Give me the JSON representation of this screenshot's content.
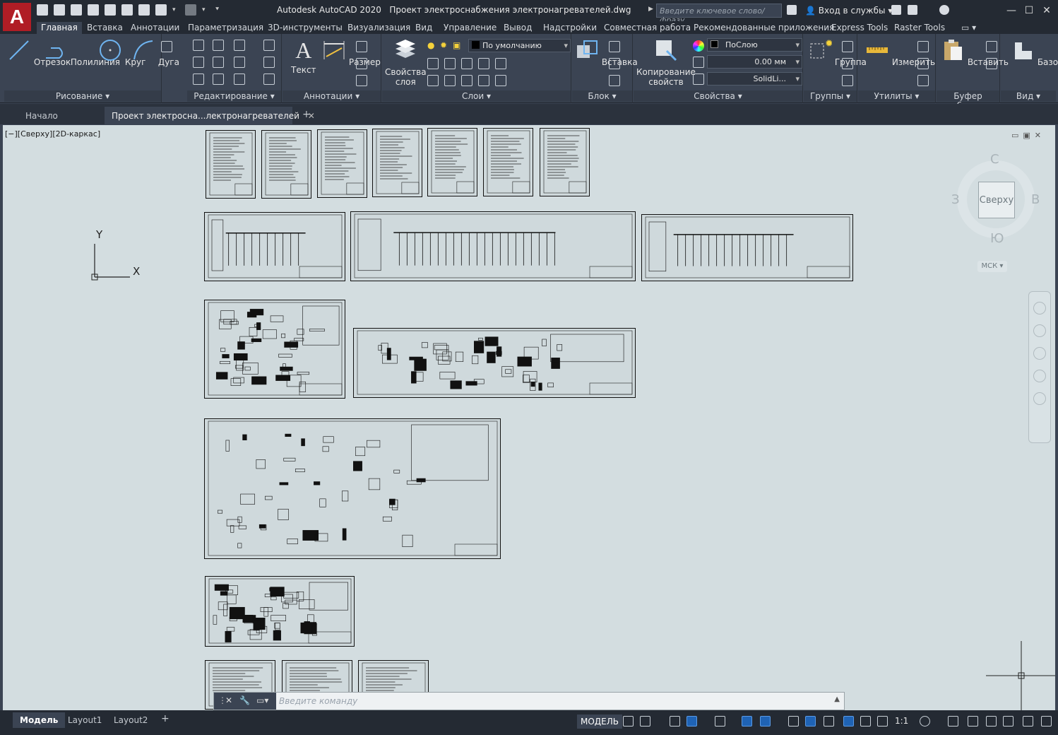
{
  "titlebar": {
    "app_name": "Autodesk AutoCAD 2020",
    "file_name": "Проект электроснабжения электронагревателей.dwg",
    "search_placeholder": "Введите ключевое слово/фразу",
    "signin_label": "Вход в службы"
  },
  "ribbon_tabs": [
    "Главная",
    "Вставка",
    "Аннотации",
    "Параметризация",
    "3D-инструменты",
    "Визуализация",
    "Вид",
    "Управление",
    "Вывод",
    "Надстройки",
    "Совместная работа",
    "Рекомендованные приложения",
    "Express Tools",
    "Raster Tools"
  ],
  "ribbon": {
    "draw": {
      "title": "Рисование",
      "line": "Отрезок",
      "polyline": "Полилиния",
      "circle": "Круг",
      "arc": "Дуга"
    },
    "modify": {
      "title": "Редактирование"
    },
    "annotation": {
      "title": "Аннотации",
      "text": "Текст",
      "dimension": "Размер"
    },
    "layers": {
      "title": "Слои",
      "layer_props_1": "Свойства",
      "layer_props_2": "слоя",
      "current_layer": "По умолчанию"
    },
    "block": {
      "title": "Блок",
      "insert": "Вставка"
    },
    "properties": {
      "title": "Свойства",
      "match_1": "Копирование",
      "match_2": "свойств",
      "color": "ПоСлою",
      "lineweight": "0.00 мм",
      "linetype": "SolidLi..."
    },
    "groups": {
      "title": "Группы",
      "group": "Группа"
    },
    "utilities": {
      "title": "Утилиты",
      "measure": "Измерить"
    },
    "clipboard": {
      "title": "Буфер обмена",
      "paste": "Вставить"
    },
    "view": {
      "title": "Вид",
      "base": "Базовый"
    }
  },
  "doc_tabs": {
    "start": "Начало",
    "active": "Проект электросна...лектронагревателей"
  },
  "canvas": {
    "viewport_label": "[−][Сверху][2D-каркас]",
    "ucs_y": "Y",
    "ucs_x": "X"
  },
  "viewcube": {
    "face": "Сверху",
    "north": "С",
    "south": "Ю",
    "west": "З",
    "east": "В",
    "wcs": "МСК"
  },
  "command_line": {
    "placeholder": "Введите команду"
  },
  "status": {
    "layout_tabs": [
      "Модель",
      "Layout1",
      "Layout2"
    ],
    "model_label": "МОДЕЛЬ",
    "scale": "1:1"
  }
}
